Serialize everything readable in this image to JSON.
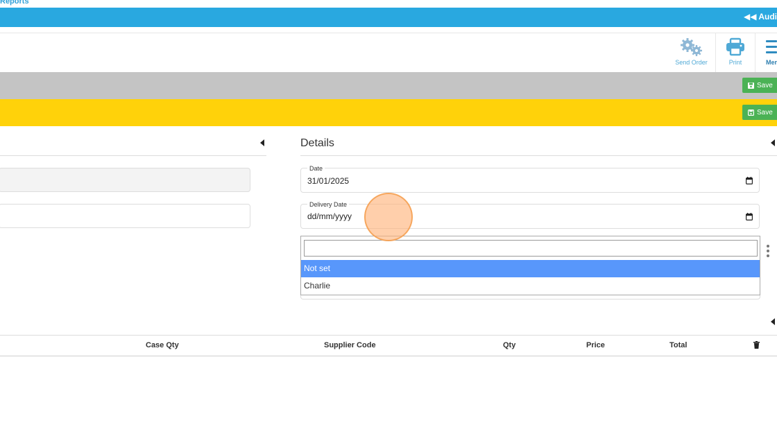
{
  "nav": {
    "link": "Reports"
  },
  "bluebar": {
    "audit_label": "Audi"
  },
  "toolbar": {
    "send_order": {
      "label": "Send Order",
      "icon": "gears-icon"
    },
    "print": {
      "label": "Print",
      "icon": "printer-icon"
    },
    "menu": {
      "label": "Mer",
      "icon": "hamburger-icon"
    }
  },
  "greybar": {
    "save_label": "Save"
  },
  "yellowbar": {
    "save_label": "Save"
  },
  "details": {
    "title": "Details",
    "date": {
      "label": "Date",
      "value": "31/01/2025"
    },
    "delivery_date": {
      "label": "Delivery Date",
      "placeholder": "dd/mm/yyyy"
    }
  },
  "dropdown": {
    "search_value": "",
    "options": [
      "Not set",
      "Charlie"
    ],
    "selected": "Not set"
  },
  "table": {
    "headers": [
      "Case Qty",
      "Supplier Code",
      "Qty",
      "Price",
      "Total"
    ]
  },
  "colors": {
    "accent_blue": "#29a8e0",
    "yellow_bar": "#ffd20a",
    "grey_bar": "#c4c4c4",
    "save_green": "#4bb255",
    "highlight": "#5897fb"
  }
}
